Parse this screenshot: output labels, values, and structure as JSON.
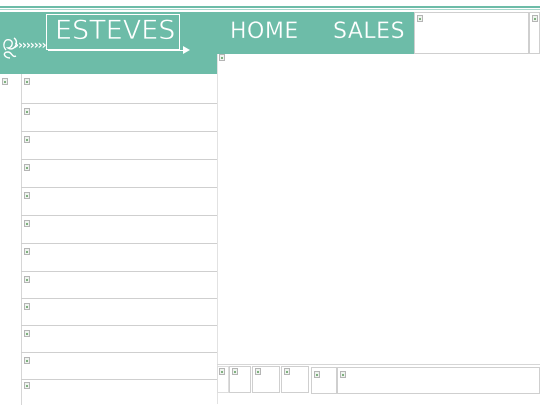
{
  "brand": {
    "logo_text": "ESTEVES"
  },
  "nav": {
    "items": [
      {
        "label": "HOME"
      },
      {
        "label": "SALES"
      }
    ]
  },
  "colors": {
    "header": "#6dbca8",
    "text_on_header": "#ffffff"
  },
  "sidebar": {
    "row_count": 12
  }
}
